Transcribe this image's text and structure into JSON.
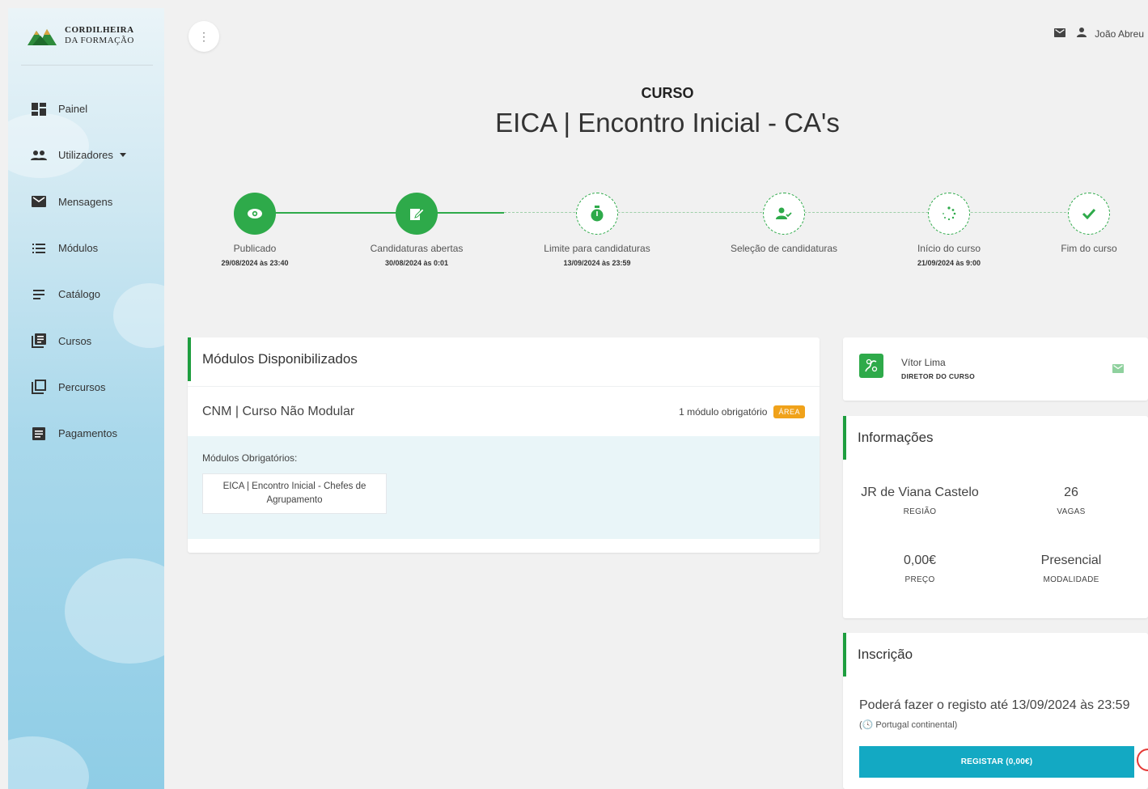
{
  "brand": {
    "line1": "CORDILHEIRA",
    "line2": "DA FORMAÇÃO"
  },
  "nav": [
    {
      "label": "Painel",
      "icon": "dashboard-icon"
    },
    {
      "label": "Utilizadores",
      "icon": "users-icon"
    },
    {
      "label": "Mensagens",
      "icon": "mail-icon"
    },
    {
      "label": "Módulos",
      "icon": "list-icon"
    },
    {
      "label": "Catálogo",
      "icon": "catalog-icon"
    },
    {
      "label": "Cursos",
      "icon": "courses-icon"
    },
    {
      "label": "Percursos",
      "icon": "paths-icon"
    },
    {
      "label": "Pagamentos",
      "icon": "payments-icon"
    }
  ],
  "topbar": {
    "menu_glyph": "⋮",
    "user_name": "João Abreu"
  },
  "course": {
    "label": "CURSO",
    "title": "EICA | Encontro Inicial - CA's"
  },
  "timeline": [
    {
      "label": "Publicado",
      "date": "29/08/2024 às 23:40",
      "status": "done",
      "icon": "eye-icon"
    },
    {
      "label": "Candidaturas abertas",
      "date": "30/08/2024 às 0:01",
      "status": "done",
      "icon": "edit-icon"
    },
    {
      "label": "Limite para candidaturas",
      "date": "13/09/2024 às 23:59",
      "status": "pending",
      "icon": "timer-icon"
    },
    {
      "label": "Seleção de candidaturas",
      "date": "",
      "status": "pending",
      "icon": "user-check-icon"
    },
    {
      "label": "Início do curso",
      "date": "21/09/2024 às 9:00",
      "status": "pending",
      "icon": "loading-icon"
    },
    {
      "label": "Fim do curso",
      "date": "",
      "status": "pending",
      "icon": "check-icon"
    }
  ],
  "modules": {
    "title": "Módulos Disponibilizados",
    "course_name": "CNM | Curso Não Modular",
    "requirement": "1 módulo obrigatório",
    "badge": "ÁREA",
    "sub_title": "Módulos Obrigatórios:",
    "module_chip": "EICA | Encontro Inicial - Chefes de Agrupamento"
  },
  "director": {
    "name": "Vítor Lima",
    "role": "DIRETOR DO CURSO"
  },
  "info": {
    "title": "Informações",
    "region_value": "JR de Viana Castelo",
    "region_label": "REGIÃO",
    "vacancies_value": "26",
    "vacancies_label": "VAGAS",
    "price_value": "0,00€",
    "price_label": "PREÇO",
    "mode_value": "Presencial",
    "mode_label": "MODALIDADE"
  },
  "inscricao": {
    "title": "Inscrição",
    "text": "Poderá fazer o registo até 13/09/2024 às 23:59",
    "timezone": "(🕓 Portugal continental)",
    "button": "REGISTAR (0,00€)"
  },
  "colors": {
    "green": "#2eaa4a",
    "accent_green": "#1e9e3f",
    "button": "#13a9c3",
    "badge": "#f0a21a"
  }
}
